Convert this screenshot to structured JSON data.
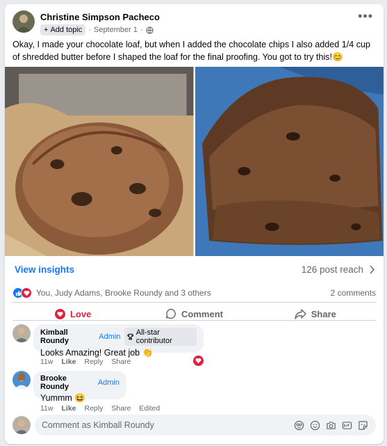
{
  "post": {
    "author": "Christine Simpson Pacheco",
    "topic_button": "Add topic",
    "date": "September 1",
    "text": "Okay, I made your chocolate loaf, but when I added the chocolate chips I also added 1/4 cup of shredded butter before I shaped the loaf for the final proofing. You got to try this!😊"
  },
  "insights": {
    "label": "View insights",
    "reach": "126 post reach"
  },
  "reactions": {
    "summary": "You, Judy Adams, Brooke Roundy and 3 others",
    "comments": "2 comments"
  },
  "actions": {
    "love": "Love",
    "comment": "Comment",
    "share": "Share"
  },
  "comments": [
    {
      "name": "Kimball Roundy",
      "badge": "Admin",
      "badge2": "All-star contributor",
      "text": "Looks Amazing! Great job 👏",
      "time": "11w",
      "like": "Like",
      "reply": "Reply",
      "share": "Share"
    },
    {
      "name": "Brooke Roundy",
      "badge": "Admin",
      "text": "Yummm 😆",
      "time": "11w",
      "like": "Like",
      "reply": "Reply",
      "share": "Share",
      "edited": "Edited"
    }
  ],
  "composer": {
    "placeholder": "Comment as Kimball Roundy"
  },
  "colors": {
    "link": "#1877f2",
    "love": "#e41e3f",
    "muted": "#65676b"
  },
  "icons": [
    "globe-icon",
    "plus-icon",
    "more-icon",
    "chevron-right-icon",
    "like-reaction-icon",
    "love-reaction-icon",
    "heart-icon",
    "comment-icon",
    "share-icon",
    "trophy-icon",
    "avatar-sticker-icon",
    "emoji-icon",
    "camera-icon",
    "gif-icon",
    "sticker-icon"
  ]
}
